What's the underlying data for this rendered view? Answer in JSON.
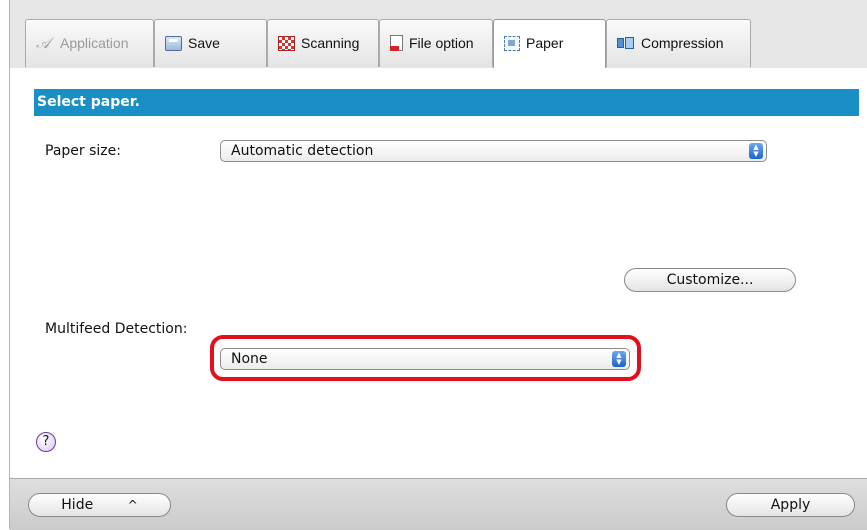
{
  "tabs": [
    {
      "label": "Application",
      "icon": "application-icon",
      "disabled": true
    },
    {
      "label": "Save",
      "icon": "save-icon"
    },
    {
      "label": "Scanning",
      "icon": "scanning-icon"
    },
    {
      "label": "File option",
      "icon": "file-option-icon"
    },
    {
      "label": "Paper",
      "icon": "paper-icon",
      "active": true
    },
    {
      "label": "Compression",
      "icon": "compression-icon"
    }
  ],
  "section": {
    "title": "Select paper."
  },
  "paper_size": {
    "label": "Paper size:",
    "value": "Automatic detection"
  },
  "customize_button": "Customize...",
  "multifeed": {
    "label": "Multifeed Detection:",
    "value": "None"
  },
  "help": {
    "glyph": "?"
  },
  "footer": {
    "hide_label": "Hide",
    "hide_chevron": "^",
    "apply_label": "Apply"
  },
  "colors": {
    "section_header_bg": "#1a8fc6",
    "highlight_border": "#e2101e",
    "select_arrow": "#1d63c9"
  }
}
